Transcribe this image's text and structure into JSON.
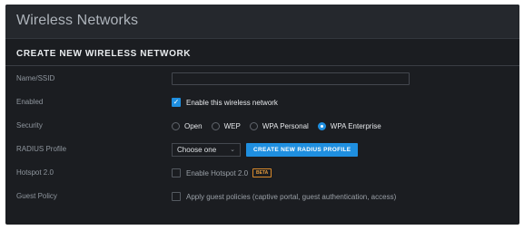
{
  "header": {
    "title": "Wireless Networks"
  },
  "section": {
    "title": "CREATE NEW WIRELESS NETWORK"
  },
  "form": {
    "ssid": {
      "label": "Name/SSID",
      "value": ""
    },
    "enabled": {
      "label": "Enabled",
      "checkbox_label": "Enable this wireless network",
      "checked": true
    },
    "security": {
      "label": "Security",
      "options": [
        "Open",
        "WEP",
        "WPA Personal",
        "WPA Enterprise"
      ],
      "selected": "WPA Enterprise"
    },
    "radius": {
      "label": "RADIUS Profile",
      "select_value": "Choose one",
      "button_label": "CREATE NEW RADIUS PROFILE"
    },
    "hotspot": {
      "label": "Hotspot 2.0",
      "checkbox_label": "Enable Hotspot 2.0",
      "badge": "BETA",
      "checked": false
    },
    "guest": {
      "label": "Guest Policy",
      "checkbox_label": "Apply guest policies (captive portal, guest authentication, access)",
      "checked": false
    }
  },
  "colors": {
    "accent": "#1f8fe0",
    "panel": "#1b1d21",
    "header": "#25282d",
    "badge": "#d98a2b"
  }
}
